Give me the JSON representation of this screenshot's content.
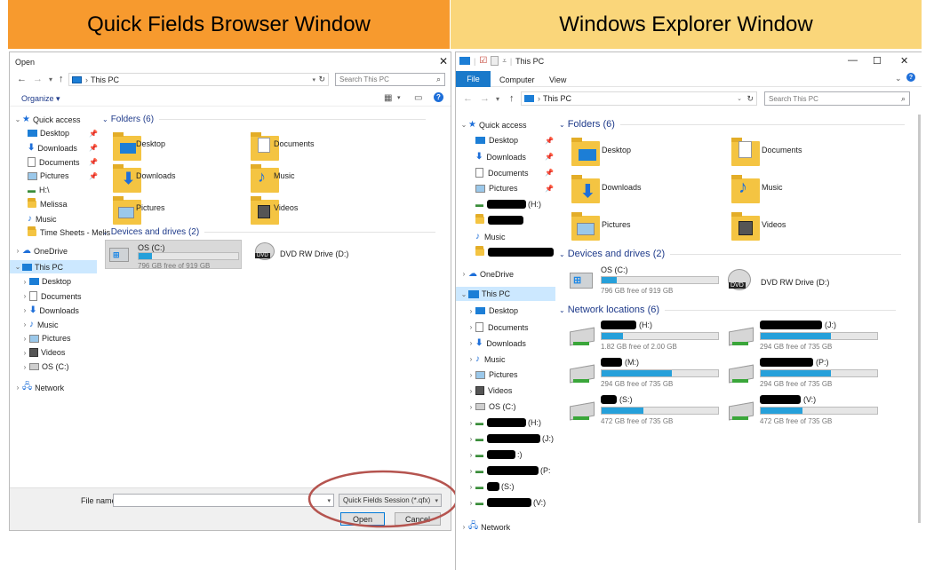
{
  "headers": {
    "left": "Quick Fields Browser Window",
    "right": "Windows Explorer Window"
  },
  "open_dialog": {
    "title": "Open",
    "address": "This PC",
    "search_placeholder": "Search This PC",
    "organize": "Organize ▾",
    "nav": {
      "quick_access": "Quick access",
      "quick_items": [
        "Desktop",
        "Downloads",
        "Documents",
        "Pictures",
        "H:\\",
        "Melissa",
        "Music",
        "Time Sheets - Melis"
      ],
      "onedrive": "OneDrive",
      "this_pc": "This PC",
      "pc_items": [
        "Desktop",
        "Documents",
        "Downloads",
        "Music",
        "Pictures",
        "Videos",
        "OS (C:)"
      ],
      "network": "Network"
    },
    "folders_heading": "Folders (6)",
    "folders": [
      "Desktop",
      "Documents",
      "Downloads",
      "Music",
      "Pictures",
      "Videos"
    ],
    "devices_heading": "Devices and drives (2)",
    "drive_c": {
      "name": "OS (C:)",
      "free": "796 GB free of 919 GB",
      "used_fraction": 0.13
    },
    "drive_dvd": {
      "name": "DVD RW Drive (D:)",
      "badge": "DVD"
    },
    "file_name_label": "File name:",
    "file_type": "Quick Fields Session (*.qfx)",
    "open_button": "Open",
    "cancel_button": "Cancel"
  },
  "explorer": {
    "title": "This PC",
    "ribbon_tabs": [
      "File",
      "Computer",
      "View"
    ],
    "address": "This PC",
    "search_placeholder": "Search This PC",
    "nav": {
      "quick_access": "Quick access",
      "quick_items": [
        "Desktop",
        "Downloads",
        "Documents",
        "Pictures",
        "(H:)",
        "",
        "Music",
        ""
      ],
      "onedrive": "OneDrive",
      "this_pc": "This PC",
      "pc_items": [
        "Desktop",
        "Documents",
        "Downloads",
        "Music",
        "Pictures",
        "Videos",
        "OS (C:)",
        "(H:)",
        "(J:)",
        ":)",
        "(P:",
        "(S:)",
        "(V:)"
      ],
      "network": "Network"
    },
    "folders_heading": "Folders (6)",
    "folders": [
      "Desktop",
      "Documents",
      "Downloads",
      "Music",
      "Pictures",
      "Videos"
    ],
    "devices_heading": "Devices and drives (2)",
    "drive_c": {
      "name": "OS (C:)",
      "free": "796 GB free of 919 GB",
      "used_fraction": 0.13
    },
    "drive_dvd": {
      "name": "DVD RW Drive (D:)",
      "badge": "DVD"
    },
    "network_heading": "Network locations (6)",
    "network_drives": [
      {
        "label": "(H:)",
        "free": "1.82 GB free of 2.00 GB",
        "used_fraction": 0.18
      },
      {
        "label": "(J:)",
        "free": "294 GB free of 735 GB",
        "used_fraction": 0.6
      },
      {
        "label": "(M:)",
        "free": "294 GB free of 735 GB",
        "used_fraction": 0.6
      },
      {
        "label": "(P:)",
        "free": "294 GB free of 735 GB",
        "used_fraction": 0.6
      },
      {
        "label": "(S:)",
        "free": "472 GB free of 735 GB",
        "used_fraction": 0.36
      },
      {
        "label": "(V:)",
        "free": "472 GB free of 735 GB",
        "used_fraction": 0.36
      }
    ]
  },
  "colors": {
    "accent": "#0078d7",
    "bar_fill": "#26a0da",
    "highlight": "#cce8ff",
    "circle": "#b5544f"
  }
}
